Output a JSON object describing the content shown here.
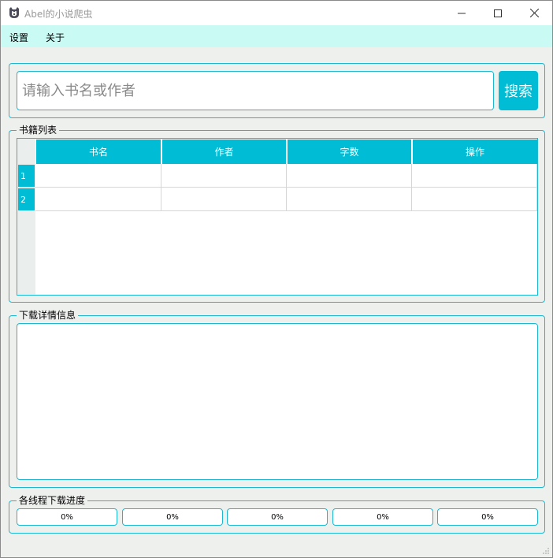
{
  "window": {
    "title": "Abel的小说爬虫",
    "accent": "#00bcd4",
    "border_color": "#1bb8cf",
    "menubar_bg": "#c9faf4"
  },
  "menu": {
    "items": [
      {
        "label": "设置"
      },
      {
        "label": "关于"
      }
    ]
  },
  "search": {
    "placeholder": "请输入书名或作者",
    "value": "",
    "button_label": "搜索"
  },
  "books": {
    "group_title": "书籍列表",
    "columns": [
      "书名",
      "作者",
      "字数",
      "操作"
    ],
    "rows": [
      {
        "num": "1",
        "cells": [
          "",
          "",
          "",
          ""
        ]
      },
      {
        "num": "2",
        "cells": [
          "",
          "",
          "",
          ""
        ]
      }
    ]
  },
  "details": {
    "group_title": "下载详情信息",
    "content": ""
  },
  "progress": {
    "group_title": "各线程下载进度",
    "bars": [
      {
        "label": "0%",
        "value": 0
      },
      {
        "label": "0%",
        "value": 0
      },
      {
        "label": "0%",
        "value": 0
      },
      {
        "label": "0%",
        "value": 0
      },
      {
        "label": "0%",
        "value": 0
      }
    ]
  },
  "icons": {
    "app": "dog-face-icon",
    "minimize": "minimize-icon",
    "maximize": "maximize-icon",
    "close": "close-icon",
    "size_grip": "size-grip-icon"
  }
}
